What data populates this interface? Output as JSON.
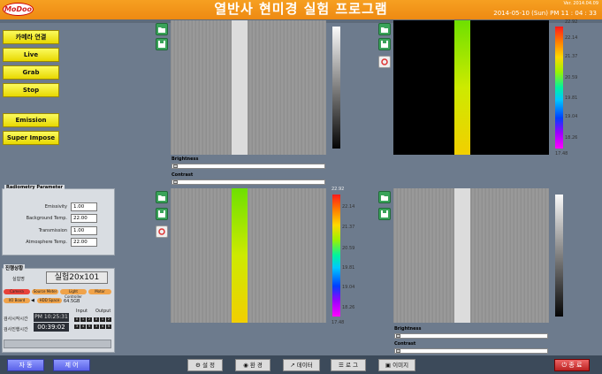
{
  "app": {
    "logo": "MoDoo",
    "title": "열반사 현미경 실험 프로그램",
    "version": "Ver. 2014.04.09",
    "datetime": "2014-05-10 (Sun)  PM 11 : 04 : 33"
  },
  "left_buttons": [
    "카메라 연결",
    "Live",
    "Grab",
    "Stop"
  ],
  "left_buttons2": [
    "Emission",
    "Super Impose"
  ],
  "radiometry": {
    "title": "Radiometry Parameter",
    "fields": [
      {
        "label": "Emissivity",
        "value": "1.00"
      },
      {
        "label": "Background Temp.",
        "value": "22.00"
      },
      {
        "label": "Transmission",
        "value": "1.00"
      },
      {
        "label": "Atmosphere Temp.",
        "value": "22.00"
      }
    ]
  },
  "experiment": {
    "title": "진행상황",
    "name_label": "실험명",
    "name": "실험20x101",
    "leds": [
      "Camera",
      "Source Meter",
      "Light Controller",
      "Motor",
      "I/O Board",
      "HDD Space"
    ],
    "hdd_value": "64.5GB",
    "start_label": "검사시작시간",
    "start_time": "PM 10:25:31",
    "elapsed_label": "검사진행시간",
    "elapsed": "00:39:02",
    "input_label": "Input",
    "output_label": "Output",
    "io_input": [
      "0",
      "1",
      "2",
      "3",
      "4",
      "5",
      "6",
      "7"
    ],
    "io_output": [
      "0",
      "1",
      "2",
      "3",
      "4",
      "5",
      "6",
      "7"
    ]
  },
  "views": [
    {
      "brightness": "Brightness",
      "contrast": "Contrast"
    },
    {
      "colorbar_ticks": [
        "22.92",
        "22.14",
        "21.37",
        "20.59",
        "19.81",
        "19.04",
        "18.26",
        "17.48"
      ]
    },
    {
      "brightness": "Brightness",
      "contrast": "Contrast",
      "colorbar_ticks": [
        "22.92",
        "22.14",
        "21.37",
        "20.59",
        "19.81",
        "19.04",
        "18.26",
        "17.48"
      ]
    },
    {
      "brightness": "Brightness",
      "contrast": "Contrast"
    }
  ],
  "bottom": {
    "auto": "자 동",
    "manual": "제 어",
    "setup": "설 정",
    "env": "환 경",
    "data": "데이터",
    "log": "로 그",
    "image": "이미지",
    "exit": "종 료"
  },
  "icons": [
    "folder-open-icon",
    "save-icon",
    "settings-icon"
  ]
}
